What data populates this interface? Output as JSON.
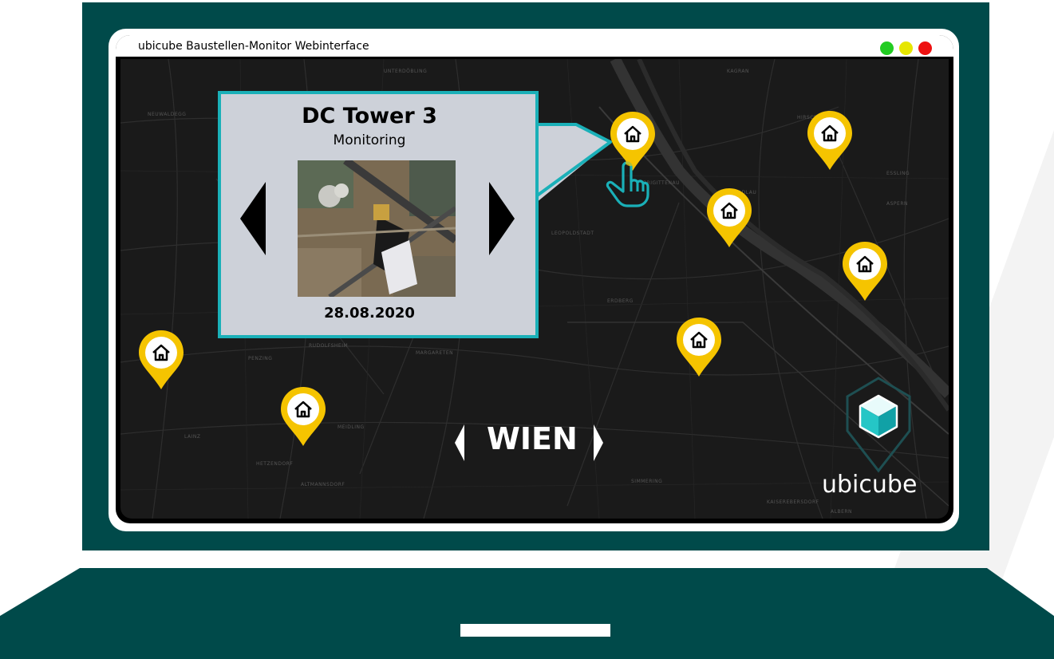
{
  "window": {
    "title": "ubicube Baustellen-Monitor Webinterface",
    "controls": [
      {
        "name": "maximize",
        "color": "#22cc22"
      },
      {
        "name": "minimize",
        "color": "#e6e600"
      },
      {
        "name": "close",
        "color": "#ee1111"
      }
    ]
  },
  "map": {
    "city": "WIEN",
    "street_labels": [
      "UNTERDÖBLING",
      "KAGRAN",
      "NEUWALDEGG",
      "HIRSCHSTETTEN",
      "ESSLING",
      "ASPERN",
      "STADLAU",
      "LEOPOLDSTADT",
      "ERDBERG",
      "MARGARETEN",
      "RUDOLFSHEIM",
      "PENZING",
      "MEIDLING",
      "HETZENDORF",
      "ALTMANNSDORF",
      "SIMMERING",
      "KAISEREBERSDORF",
      "ALBERN",
      "LAINZ",
      "BRIGITTENAU"
    ],
    "marker_icon": "home-icon",
    "marker_color": "#f5c400"
  },
  "popup": {
    "title": "DC Tower 3",
    "subtitle": "Monitoring",
    "date": "28.08.2020",
    "border_color": "#1ab0b8",
    "prev_icon": "triangle-left-icon",
    "next_icon": "triangle-right-icon"
  },
  "brand": {
    "name": "ubicube",
    "logo_icon": "cube-logo-icon"
  },
  "cursor": "hand-pointer-icon"
}
